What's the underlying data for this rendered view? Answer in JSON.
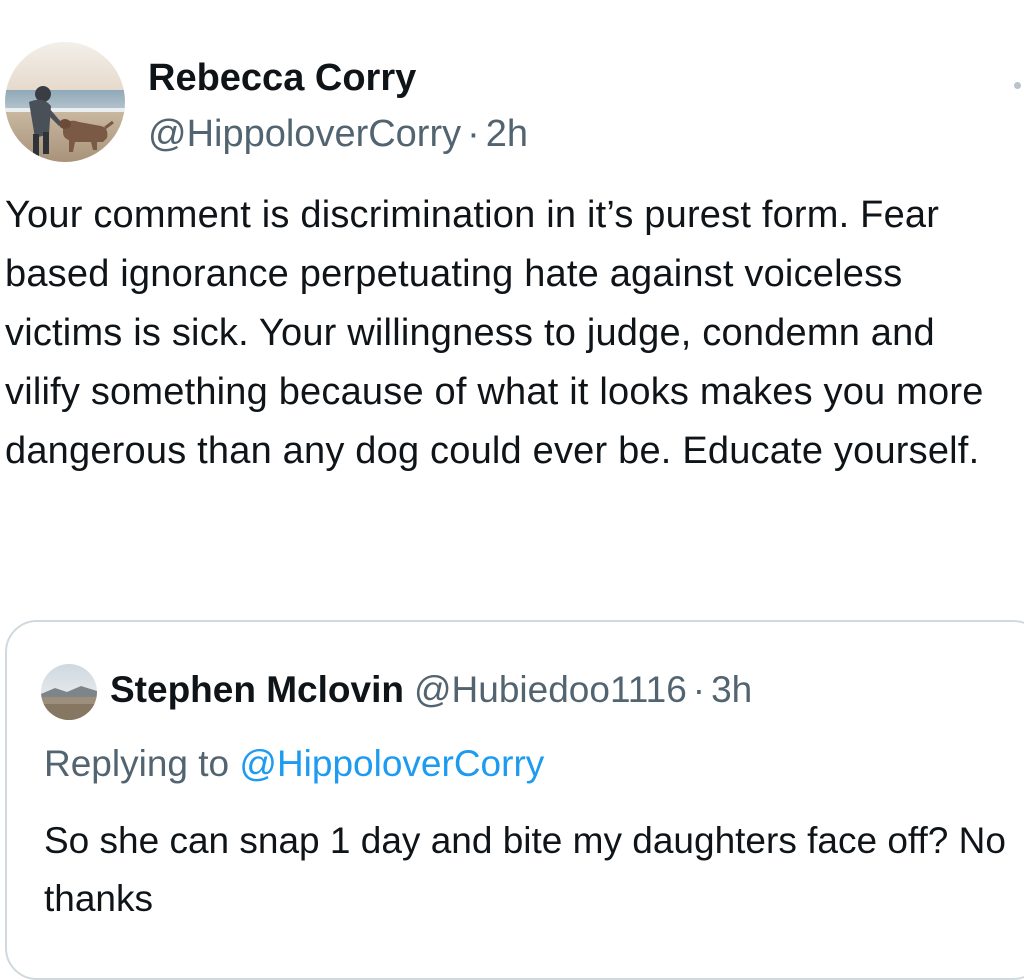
{
  "tweet": {
    "author": {
      "display_name": "Rebecca Corry",
      "handle": "@HippoloverCorry",
      "avatar": "avatar-beach-dog"
    },
    "separator": "·",
    "time": "2h",
    "text": "Your comment is discrimination in it’s purest form. Fear based ignorance perpetuating hate against voiceless victims is sick. Your willingness to judge, condemn and vilify something because of what it looks makes you more dangerous than any dog could ever be. Educate yourself.",
    "more_icon": "more-dot-icon"
  },
  "quoted_tweet": {
    "author": {
      "display_name": "Stephen Mclovin",
      "handle": "@Hubiedoo1116",
      "avatar": "avatar-landscape"
    },
    "separator": "·",
    "time": "3h",
    "replying_prefix": "Replying to",
    "replying_to": "@HippoloverCorry",
    "text": "So she can snap 1 day and bite my daughters face off? No thanks"
  },
  "colors": {
    "text_primary": "#0f1419",
    "text_secondary": "#536471",
    "mention": "#1d9bf0",
    "border": "#cfd9de"
  }
}
